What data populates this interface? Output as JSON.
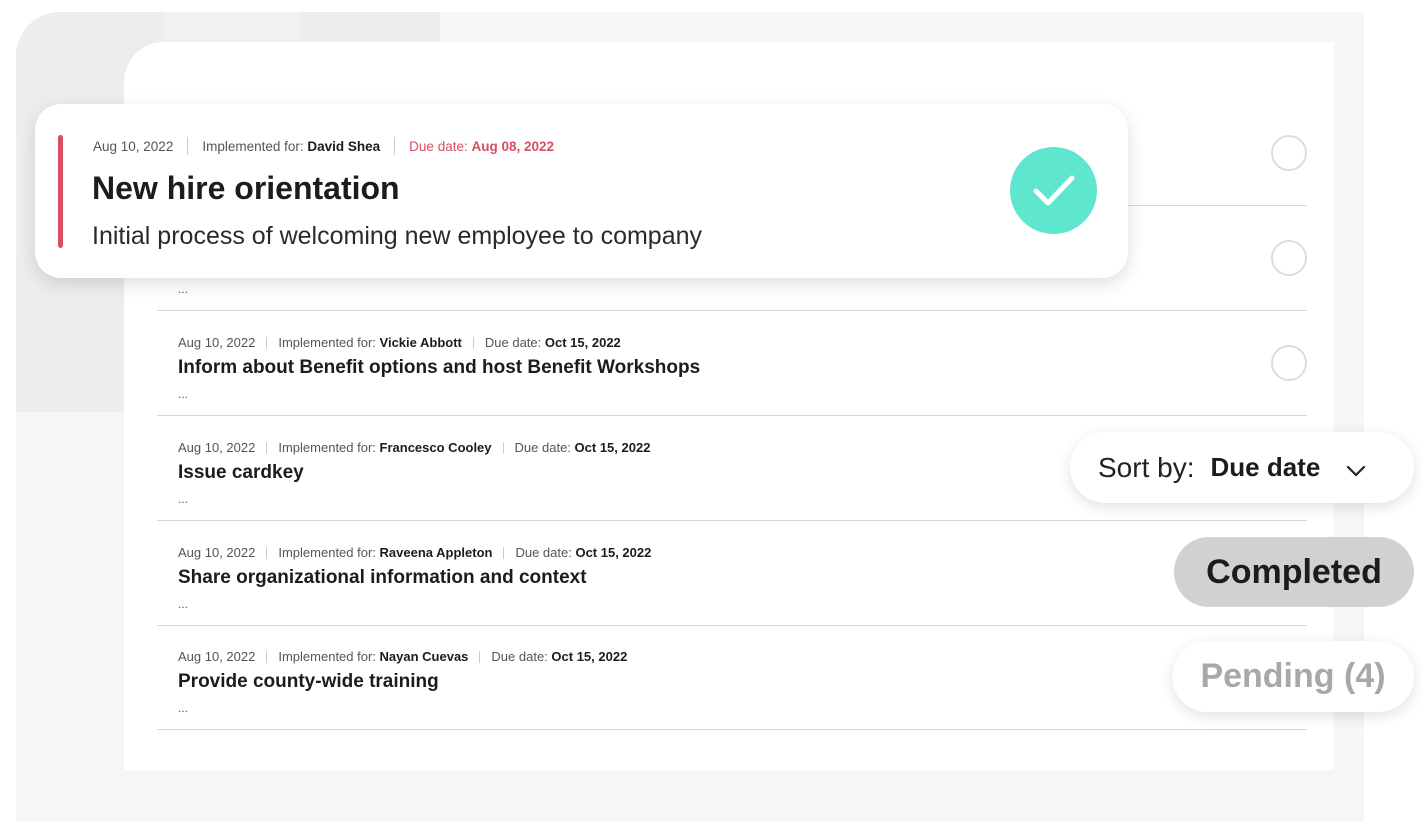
{
  "featured": {
    "date": "Aug 10, 2022",
    "implemented_label": "Implemented for:",
    "implemented_for": "David Shea",
    "due_label": "Due date:",
    "due_date": "Aug 08, 2022",
    "title": "New hire orientation",
    "description": "Initial process of welcoming new employee to company",
    "status_icon": "check-icon",
    "accent_color": "#d84f5f",
    "check_color": "#5ee6cf"
  },
  "rows": [
    {
      "ellipsis": "..."
    },
    {
      "date": "Aug 10, 2022",
      "implemented_label": "Implemented for:",
      "implemented_for": "Vickie Abbott",
      "due_label": "Due date:",
      "due_date": "Oct 15, 2022",
      "title": "Inform about Benefit options and host Benefit Workshops",
      "ellipsis": "..."
    },
    {
      "date": "Aug 10, 2022",
      "implemented_label": "Implemented for:",
      "implemented_for": "Francesco Cooley",
      "due_label": "Due date:",
      "due_date": "Oct 15, 2022",
      "title": "Issue cardkey",
      "ellipsis": "..."
    },
    {
      "date": "Aug 10, 2022",
      "implemented_label": "Implemented for:",
      "implemented_for": "Raveena Appleton",
      "due_label": "Due date:",
      "due_date": "Oct 15, 2022",
      "title": "Share organizational information and context",
      "ellipsis": "..."
    },
    {
      "date": "Aug 10, 2022",
      "implemented_label": "Implemented for:",
      "implemented_for": "Nayan Cuevas",
      "due_label": "Due date:",
      "due_date": "Oct 15, 2022",
      "title": "Provide county-wide training",
      "ellipsis": "..."
    }
  ],
  "sort": {
    "label": "Sort by:",
    "value": "Due date"
  },
  "filters": {
    "completed": "Completed",
    "pending": "Pending (4)"
  }
}
